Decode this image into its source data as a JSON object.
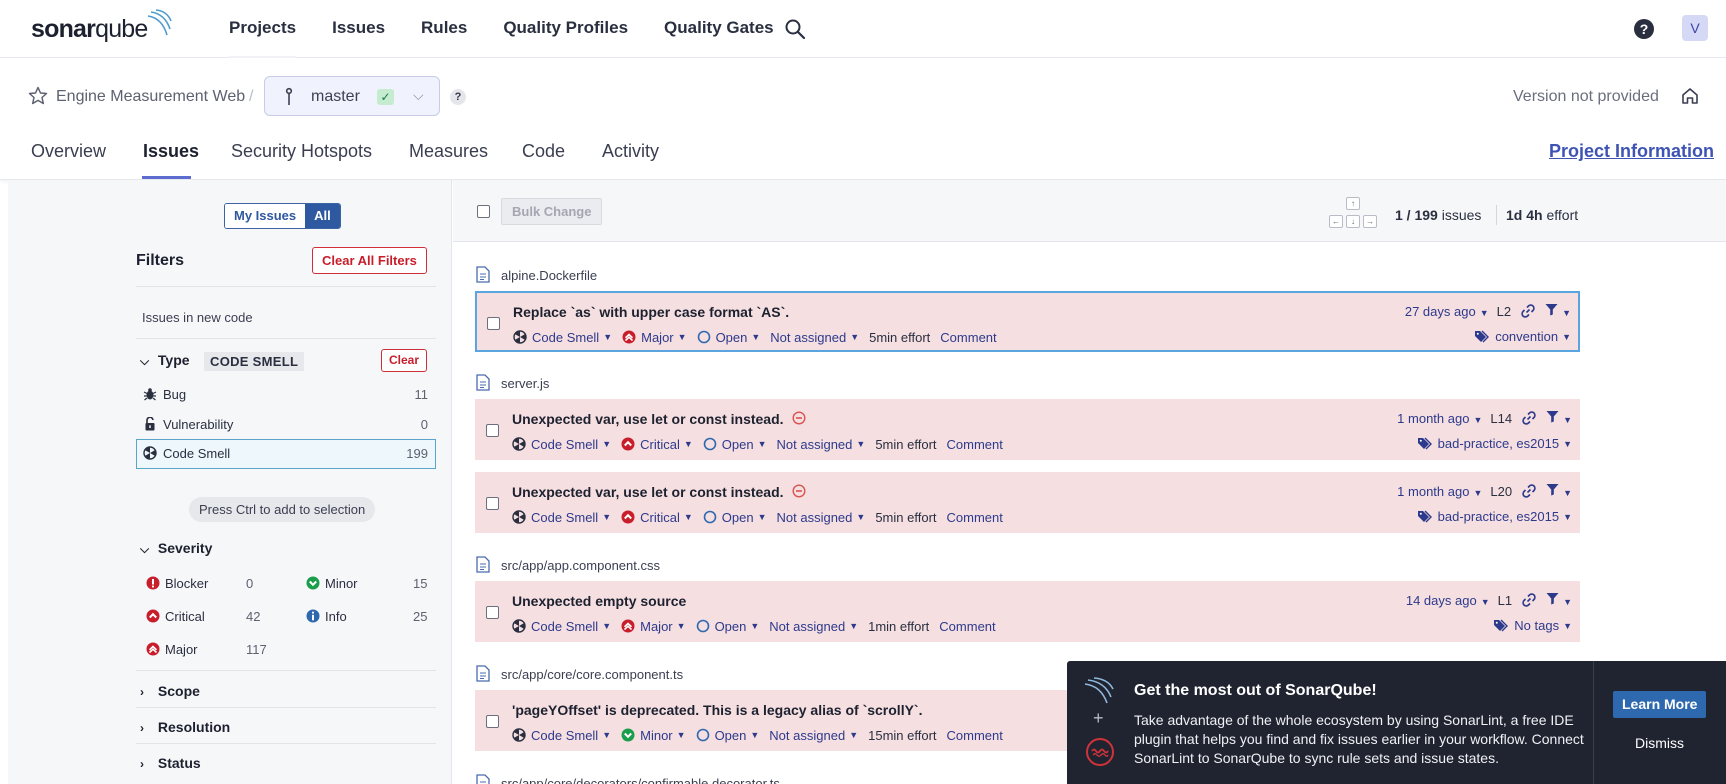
{
  "app": {
    "logo_left": "sonar",
    "logo_right": "qube"
  },
  "nav": {
    "items": [
      "Projects",
      "Issues",
      "Rules",
      "Quality Profiles",
      "Quality Gates"
    ]
  },
  "user": {
    "avatar": "V",
    "help": "?"
  },
  "breadcrumb": {
    "project": "Engine Measurement Web",
    "separator": "/",
    "branch": "master",
    "branch_status": "✓",
    "help": "?",
    "version": "Version not provided"
  },
  "project_tabs": [
    "Overview",
    "Issues",
    "Security Hotspots",
    "Measures",
    "Code",
    "Activity"
  ],
  "project_info": "Project Information",
  "sidebar": {
    "toggle": {
      "mine": "My Issues",
      "all": "All"
    },
    "filters_title": "Filters",
    "clear_all": "Clear All Filters",
    "new_code": "Issues in new code",
    "type": {
      "title": "Type",
      "tag": "CODE SMELL",
      "clear": "Clear",
      "items": [
        {
          "label": "Bug",
          "count": "11"
        },
        {
          "label": "Vulnerability",
          "count": "0"
        },
        {
          "label": "Code Smell",
          "count": "199"
        }
      ]
    },
    "ctrl_hint": "Press Ctrl to add to selection",
    "severity": {
      "title": "Severity",
      "items": [
        {
          "label": "Blocker",
          "count": "0"
        },
        {
          "label": "Minor",
          "count": "15"
        },
        {
          "label": "Critical",
          "count": "42"
        },
        {
          "label": "Info",
          "count": "25"
        },
        {
          "label": "Major",
          "count": "117"
        }
      ]
    },
    "collapsed_facets": [
      "Scope",
      "Resolution",
      "Status"
    ]
  },
  "list": {
    "bulk_change": "Bulk Change",
    "keys": {
      "up": "↑",
      "left": "←",
      "down": "↓",
      "right": "→"
    },
    "count_current": "1 / 199",
    "count_suffix": "issues",
    "effort_value": "1d 4h",
    "effort_suffix": "effort"
  },
  "files": [
    "alpine.Dockerfile",
    "server.js",
    "src/app/app.component.css",
    "src/app/core/core.component.ts",
    "src/app/core/decorators/confirmable.decorator.ts"
  ],
  "issues": [
    {
      "title": "Replace `as` with upper case format `AS`.",
      "type": "Code Smell",
      "severity": "Major",
      "status": "Open",
      "assignee": "Not assigned",
      "effort": "5min effort",
      "comment": "Comment",
      "age": "27 days ago",
      "line": "L2",
      "tags": "convention"
    },
    {
      "title": "Unexpected var, use let or const instead.",
      "type": "Code Smell",
      "severity": "Critical",
      "status": "Open",
      "assignee": "Not assigned",
      "effort": "5min effort",
      "comment": "Comment",
      "age": "1 month ago",
      "line": "L14",
      "tags": "bad-practice, es2015"
    },
    {
      "title": "Unexpected var, use let or const instead.",
      "type": "Code Smell",
      "severity": "Critical",
      "status": "Open",
      "assignee": "Not assigned",
      "effort": "5min effort",
      "comment": "Comment",
      "age": "1 month ago",
      "line": "L20",
      "tags": "bad-practice, es2015"
    },
    {
      "title": "Unexpected empty source",
      "type": "Code Smell",
      "severity": "Major",
      "status": "Open",
      "assignee": "Not assigned",
      "effort": "1min effort",
      "comment": "Comment",
      "age": "14 days ago",
      "line": "L1",
      "tags": "No tags"
    },
    {
      "title": "'pageYOffset' is deprecated. This is a legacy alias of `scrollY`.",
      "type": "Code Smell",
      "severity": "Minor",
      "status": "Open",
      "assignee": "Not assigned",
      "effort": "15min effort",
      "comment": "Comment"
    }
  ],
  "promo": {
    "title": "Get the most out of SonarQube!",
    "body": "Take advantage of the whole ecosystem by using SonarLint, a free IDE plugin that helps you find and fix issues earlier in your workflow. Connect SonarLint to SonarQube to sync rule sets and issue states.",
    "plus": "+",
    "learn_more": "Learn More",
    "dismiss": "Dismiss"
  },
  "colors": {
    "issue_bg": "#f5dfe1",
    "link": "#2d3a8c",
    "accent": "#5d6cd0",
    "danger": "#c81e2b",
    "minor": "#1b9e4b",
    "info": "#2e69b0",
    "promo_bg": "#202430"
  }
}
